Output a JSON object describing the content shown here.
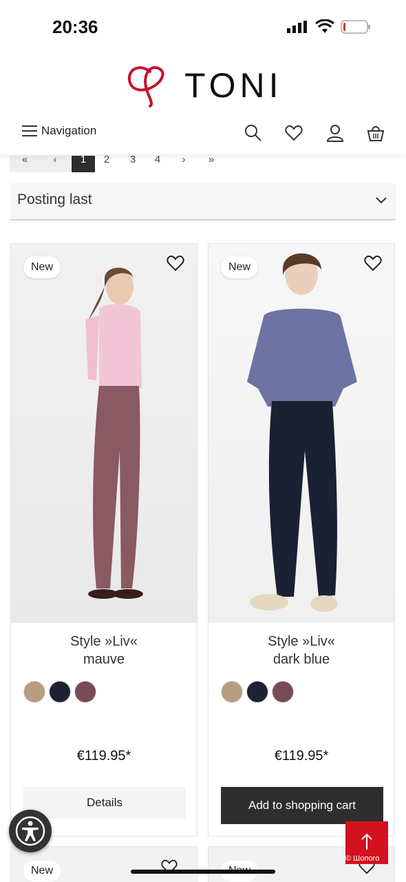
{
  "status_bar": {
    "time": "20:36"
  },
  "brand": {
    "name": "TONI",
    "accent": "#c8102e"
  },
  "nav": {
    "menu_label": "Navigation"
  },
  "pagination": {
    "pages": [
      "«",
      "‹",
      "1",
      "2",
      "3",
      "4",
      "›",
      "»"
    ],
    "active_page": "1"
  },
  "sort": {
    "selected": "Posting last"
  },
  "products": [
    {
      "badge": "New",
      "name_line1": "Style »Liv«",
      "name_line2": "mauve",
      "swatches": [
        "#b79e80",
        "#1e2235",
        "#7a4b55"
      ],
      "price": "€119.95*",
      "button": "Details",
      "pants_color": "#8a5a64",
      "top_color": "#f2c6d6"
    },
    {
      "badge": "New",
      "name_line1": "Style »Liv«",
      "name_line2": "dark blue",
      "swatches": [
        "#b79e80",
        "#1e2235",
        "#7a4b55"
      ],
      "price": "€119.95*",
      "button": "Add to shopping cart",
      "pants_color": "#1c2033",
      "top_color": "#6d73a2"
    }
  ],
  "next_row": [
    {
      "badge": "New"
    },
    {
      "badge": "New"
    }
  ],
  "floating": {
    "watermark": "© Шопого"
  }
}
